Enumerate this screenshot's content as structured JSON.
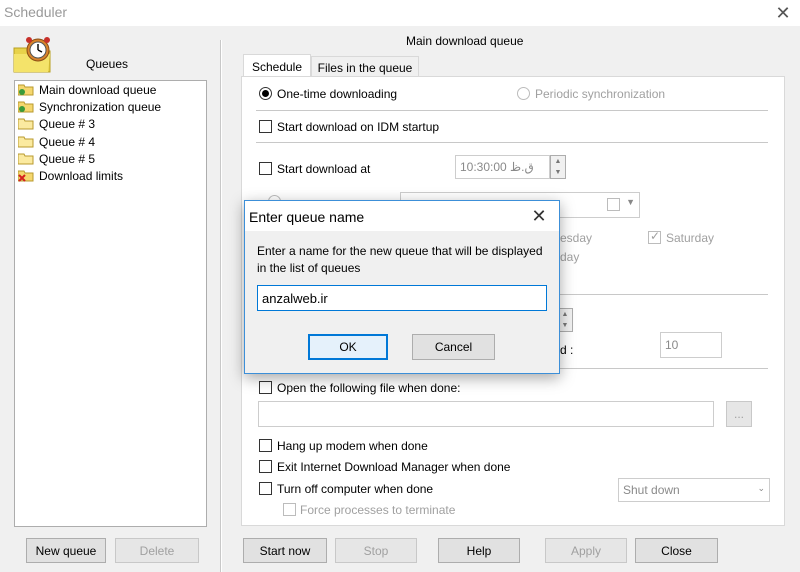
{
  "window": {
    "title": "Scheduler"
  },
  "left": {
    "heading": "Queues",
    "queues": [
      {
        "label": "Main download queue",
        "icon": "folder-clock-icon"
      },
      {
        "label": "Synchronization queue",
        "icon": "folder-sync-icon"
      },
      {
        "label": "Queue # 3",
        "icon": "folder-icon"
      },
      {
        "label": "Queue # 4",
        "icon": "folder-icon"
      },
      {
        "label": "Queue # 5",
        "icon": "folder-icon"
      },
      {
        "label": "Download limits",
        "icon": "limit-x-icon"
      }
    ],
    "new_queue_label": "New queue",
    "delete_label": "Delete"
  },
  "main": {
    "title": "Main download queue",
    "tabs": [
      "Schedule",
      "Files in the queue"
    ],
    "one_time_label": "One-time downloading",
    "periodic_label": "Periodic synchronization",
    "start_on_startup_label": "Start download on IDM startup",
    "start_at_label": "Start download at",
    "start_time": "10:30:00 ق.ظ",
    "days_partial": [
      "esday",
      "day"
    ],
    "saturday_label": "Saturday",
    "partial_colon": "d :",
    "retry_value": "10",
    "open_file_label": "Open the following file when done:",
    "browse_label": "...",
    "hang_up_label": "Hang up modem when done",
    "exit_idm_label": "Exit Internet Download Manager when done",
    "turn_off_label": "Turn off computer when done",
    "shutdown_option": "Shut down",
    "force_label": "Force processes to terminate"
  },
  "footer": {
    "start_now": "Start now",
    "stop": "Stop",
    "help": "Help",
    "apply": "Apply",
    "close": "Close"
  },
  "dialog": {
    "title": "Enter queue name",
    "message": "Enter a name for the new queue that will be displayed in the list of queues",
    "input_value": "anzalweb.ir",
    "ok_label": "OK",
    "cancel_label": "Cancel"
  },
  "colors": {
    "accent": "#0078d7",
    "folder": "#f5d76e"
  }
}
